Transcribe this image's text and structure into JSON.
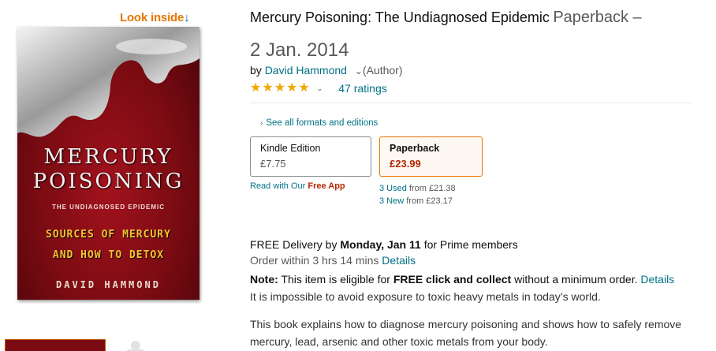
{
  "look_inside": {
    "label": "Look inside",
    "arrow": "↓"
  },
  "cover": {
    "title_line1": "MERCURY",
    "title_line2": "POISONING",
    "subtitle": "THE UNDIAGNOSED EPIDEMIC",
    "tagline_line1": "SOURCES OF MERCURY",
    "tagline_line2": "AND HOW TO DETOX",
    "author": "DAVID HAMMOND"
  },
  "product": {
    "title": "Mercury Poisoning: The Undiagnosed Epidemic",
    "format_label": "Paperback –",
    "date": "2 Jan. 2014",
    "by": "by",
    "author_name": "David Hammond",
    "author_role": "(Author)",
    "rating_value": 5,
    "rating_count": "47 ratings"
  },
  "formats": {
    "see_all": "See all formats and editions",
    "kindle": {
      "name": "Kindle Edition",
      "price": "£7.75"
    },
    "paperback": {
      "name": "Paperback",
      "price": "£23.99"
    },
    "free_app_prefix": "Read with Our",
    "free_app_bold": "Free App",
    "used_link": "3 Used",
    "used_from": "from £21.38",
    "new_link": "3 New",
    "new_from": "from £23.17"
  },
  "delivery": {
    "prefix": "FREE Delivery by",
    "date": "Monday, Jan 11",
    "suffix": "for Prime members",
    "order_within": "Order within 3 hrs 14 mins",
    "details": "Details"
  },
  "note": {
    "label": "Note:",
    "text1": "This item is eligible for",
    "bold": "FREE click and collect",
    "text2": "without a minimum order.",
    "details": "Details"
  },
  "description": {
    "para1": "It is impossible to avoid exposure to toxic heavy metals in today’s world.",
    "para2": "This book explains how to diagnose mercury poisoning and shows how to safely remove mercury, lead, arsenic and other toxic metals from your body."
  },
  "icons": {
    "star": "★",
    "chevron_down": "⌄",
    "chevron_right": "›"
  },
  "colors": {
    "link": "#007185",
    "price_red": "#b12704",
    "look_inside_orange": "#e77600",
    "star": "#f0a800"
  }
}
